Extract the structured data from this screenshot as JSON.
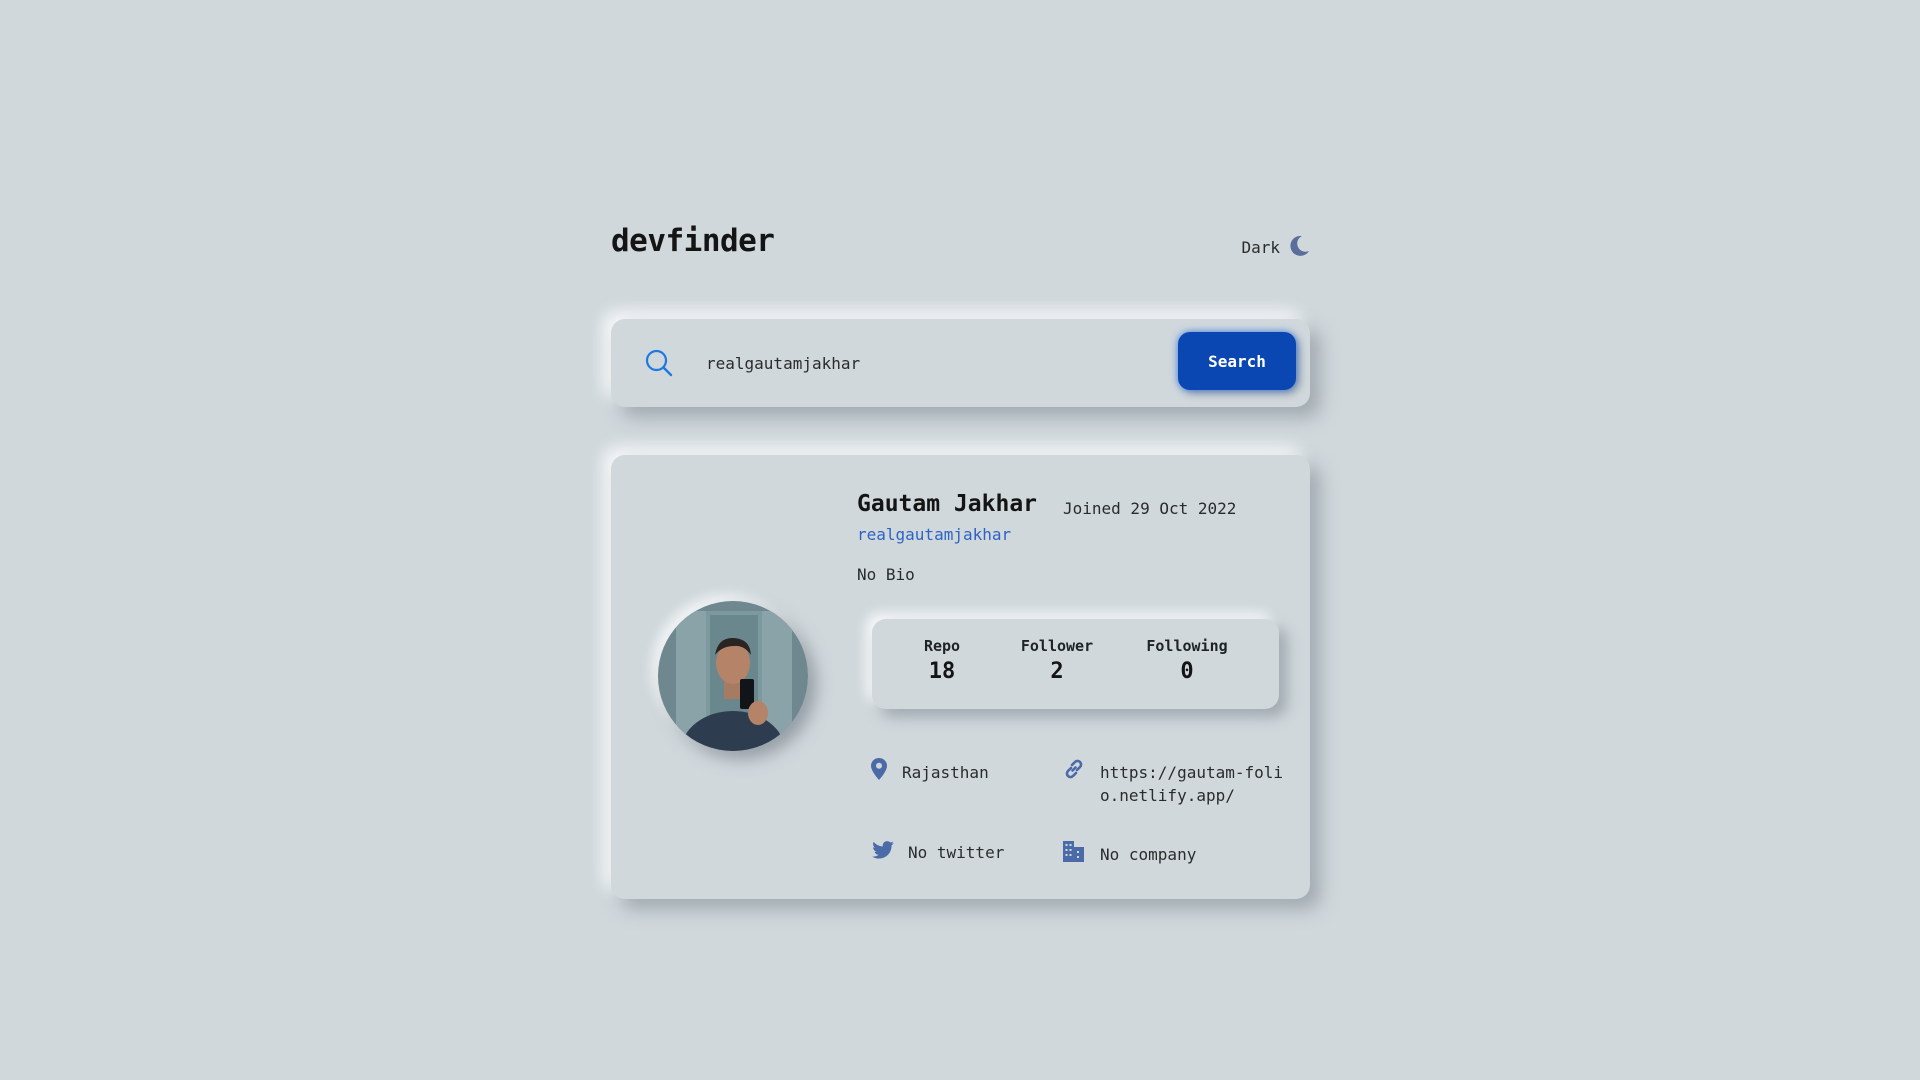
{
  "header": {
    "logo": "devfinder",
    "theme_label": "Dark",
    "theme_icon": "moon-icon"
  },
  "search": {
    "icon": "search-icon",
    "value": "realgautamjakhar",
    "placeholder": "",
    "button_label": "Search"
  },
  "profile": {
    "name": "Gautam Jakhar",
    "joined": "Joined 29 Oct 2022",
    "username": "realgautamjakhar",
    "bio": "No Bio",
    "stats": {
      "repo_label": "Repo",
      "repo_value": "18",
      "follower_label": "Follower",
      "follower_value": "2",
      "following_label": "Following",
      "following_value": "0"
    },
    "location": "Rajasthan",
    "website": "https://gautam-folio.netlify.app/",
    "twitter": "No twitter",
    "company": "No company"
  },
  "colors": {
    "background": "#d0d8dc",
    "accent": "#0b47b2",
    "link": "#2c63c4",
    "icon": "#4a6aa8"
  }
}
